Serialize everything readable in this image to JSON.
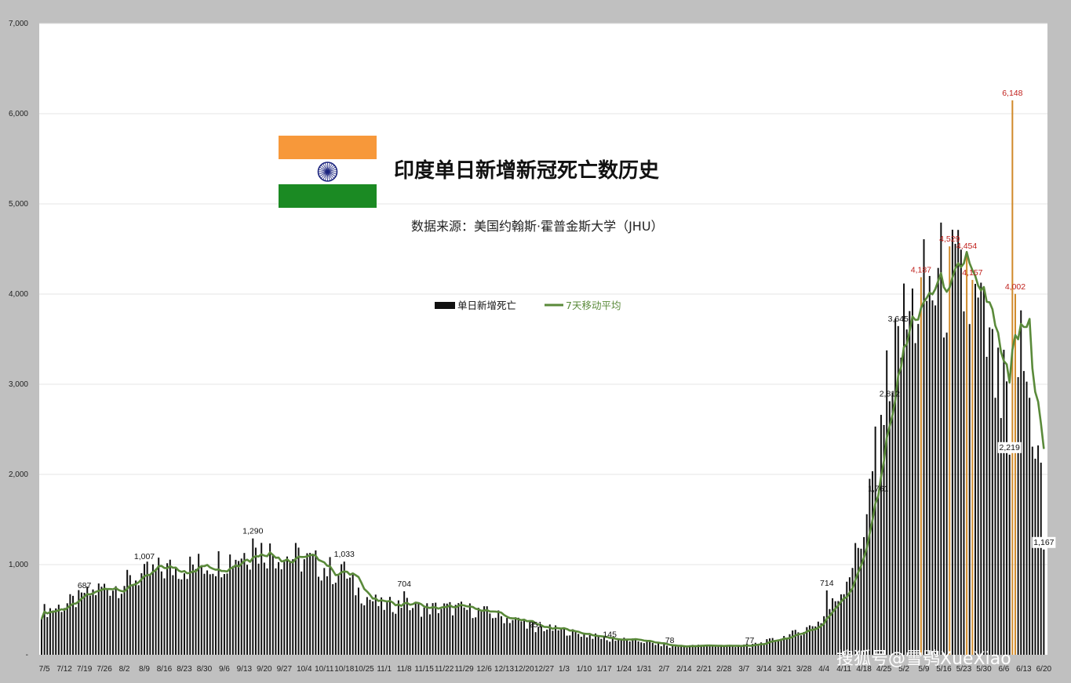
{
  "chart_data": {
    "type": "bar",
    "title": "印度单日新增新冠死亡数历史",
    "subtitle": "数据来源：美国约翰斯·霍普金斯大学（JHU）",
    "legend": {
      "placement": "center",
      "bar_series": "单日新增死亡",
      "line_series": "7天移动平均"
    },
    "ylim": [
      0,
      7000
    ],
    "y_ticks": [
      {
        "value": 0,
        "label": "-"
      },
      {
        "value": 1000,
        "label": "1,000"
      },
      {
        "value": 2000,
        "label": "2,000"
      },
      {
        "value": 3000,
        "label": "3,000"
      },
      {
        "value": 4000,
        "label": "4,000"
      },
      {
        "value": 5000,
        "label": "5,000"
      },
      {
        "value": 6000,
        "label": "6,000"
      },
      {
        "value": 7000,
        "label": "7,000"
      }
    ],
    "grid": true,
    "x_ticks": [
      "7/5",
      "7/12",
      "7/19",
      "7/26",
      "8/2",
      "8/9",
      "8/16",
      "8/23",
      "8/30",
      "9/6",
      "9/13",
      "9/20",
      "9/27",
      "10/4",
      "10/11",
      "10/18",
      "10/25",
      "11/1",
      "11/8",
      "11/15",
      "11/22",
      "11/29",
      "12/6",
      "12/13",
      "12/20",
      "12/27",
      "1/3",
      "1/10",
      "1/17",
      "1/24",
      "1/31",
      "2/7",
      "2/14",
      "2/21",
      "2/28",
      "3/7",
      "3/14",
      "3/21",
      "3/28",
      "4/4",
      "4/11",
      "4/18",
      "4/25",
      "5/2",
      "5/9",
      "5/16",
      "5/23",
      "5/30",
      "6/6",
      "6/13",
      "6/20"
    ],
    "weekly_avg": [
      480,
      540,
      620,
      740,
      770,
      880,
      940,
      970,
      990,
      1040,
      1120,
      1160,
      1110,
      1060,
      980,
      880,
      680,
      540,
      560,
      510,
      520,
      510,
      480,
      420,
      370,
      300,
      270,
      230,
      190,
      170,
      150,
      110,
      95,
      100,
      100,
      100,
      130,
      190,
      260,
      380,
      700,
      1250,
      2600,
      3550,
      3950,
      4120,
      4080,
      3700,
      2800,
      3400,
      2000
    ],
    "annotations": [
      {
        "label": "687",
        "x": "7/19",
        "value": 687,
        "color": "black"
      },
      {
        "label": "1,007",
        "x": "8/9",
        "value": 1007,
        "color": "black"
      },
      {
        "label": "1,290",
        "x": "9/16",
        "value": 1290,
        "color": "black"
      },
      {
        "label": "1,033",
        "x": "10/18",
        "value": 1033,
        "color": "black"
      },
      {
        "label": "704",
        "x": "11/8",
        "value": 704,
        "color": "black"
      },
      {
        "label": "251",
        "x": "12/24",
        "value": 251,
        "color": "black"
      },
      {
        "label": "145",
        "x": "1/19",
        "value": 145,
        "color": "black"
      },
      {
        "label": "78",
        "x": "2/9",
        "value": 78,
        "color": "black"
      },
      {
        "label": "77",
        "x": "3/9",
        "value": 77,
        "color": "black"
      },
      {
        "label": "714",
        "x": "4/5",
        "value": 714,
        "color": "black"
      },
      {
        "label": "1,761",
        "x": "4/23",
        "value": 1761,
        "color": "black"
      },
      {
        "label": "2,812",
        "x": "4/27",
        "value": 2812,
        "color": "black"
      },
      {
        "label": "3,645",
        "x": "4/30",
        "value": 3645,
        "color": "black"
      },
      {
        "label": "4,187",
        "x": "5/8",
        "value": 4187,
        "color": "red"
      },
      {
        "label": "4,529",
        "x": "5/18",
        "value": 4529,
        "color": "red"
      },
      {
        "label": "4,454",
        "x": "5/24",
        "value": 4454,
        "color": "red"
      },
      {
        "label": "4,157",
        "x": "5/26",
        "value": 4157,
        "color": "red"
      },
      {
        "label": "4,002",
        "x": "6/10",
        "value": 4002,
        "color": "red"
      },
      {
        "label": "6,148",
        "x": "6/9",
        "value": 6148,
        "color": "red"
      },
      {
        "label": "2,219",
        "x": "6/8",
        "value": 2219,
        "color": "black"
      },
      {
        "label": "1,167",
        "x": "6/21",
        "value": 1167,
        "color": "black"
      }
    ],
    "colors": {
      "bars": "#111111",
      "highlight_bars": "#d08a2a",
      "line": "#5a8a3a",
      "grid": "#e4e4e4",
      "annotation_red": "#c0201c"
    }
  },
  "flag": {
    "colors": [
      "#f7983a",
      "#ffffff",
      "#1b8a23"
    ],
    "wheel_color": "#1a237e"
  },
  "watermark": "搜狐号@雪鸮XueXiao"
}
